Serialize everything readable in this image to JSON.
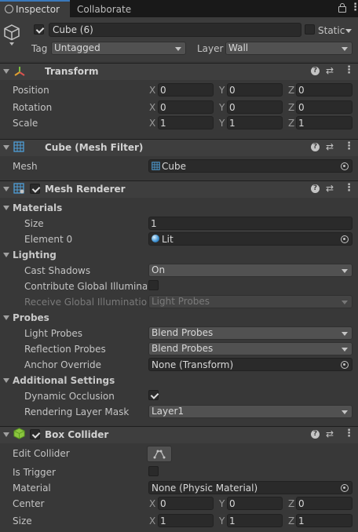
{
  "tabs": {
    "inspector": "Inspector",
    "collaborate": "Collaborate"
  },
  "object": {
    "active": true,
    "name": "Cube (6)",
    "static_label": "Static",
    "tag_label": "Tag",
    "tag_value": "Untagged",
    "layer_label": "Layer",
    "layer_value": "Wall"
  },
  "transform": {
    "title": "Transform",
    "position_label": "Position",
    "position": {
      "x": "0",
      "y": "0",
      "z": "0"
    },
    "rotation_label": "Rotation",
    "rotation": {
      "x": "0",
      "y": "0",
      "z": "0"
    },
    "scale_label": "Scale",
    "scale": {
      "x": "1",
      "y": "1",
      "z": "1"
    }
  },
  "axis": {
    "x": "X",
    "y": "Y",
    "z": "Z"
  },
  "mesh_filter": {
    "title": "Cube (Mesh Filter)",
    "mesh_label": "Mesh",
    "mesh_value": "Cube"
  },
  "mesh_renderer": {
    "title": "Mesh Renderer",
    "enabled": true,
    "materials_label": "Materials",
    "size_label": "Size",
    "size_value": "1",
    "element0_label": "Element 0",
    "element0_value": "Lit",
    "lighting_label": "Lighting",
    "cast_shadows_label": "Cast Shadows",
    "cast_shadows_value": "On",
    "contribute_gi_label": "Contribute Global Illuminatic",
    "receive_gi_label": "Receive Global Illumination",
    "receive_gi_value": "Light Probes",
    "probes_label": "Probes",
    "light_probes_label": "Light Probes",
    "light_probes_value": "Blend Probes",
    "reflection_probes_label": "Reflection Probes",
    "reflection_probes_value": "Blend Probes",
    "anchor_override_label": "Anchor Override",
    "anchor_override_value": "None (Transform)",
    "additional_settings_label": "Additional Settings",
    "dynamic_occlusion_label": "Dynamic Occlusion",
    "rendering_layer_mask_label": "Rendering Layer Mask",
    "rendering_layer_mask_value": "Layer1"
  },
  "box_collider": {
    "title": "Box Collider",
    "enabled": true,
    "edit_collider_label": "Edit Collider",
    "is_trigger_label": "Is Trigger",
    "material_label": "Material",
    "material_value": "None (Physic Material)",
    "center_label": "Center",
    "center": {
      "x": "0",
      "y": "0",
      "z": "0"
    },
    "size_label": "Size",
    "size": {
      "x": "1",
      "y": "1",
      "z": "1"
    }
  },
  "icons": {
    "help": "?",
    "kebab": "⋮"
  }
}
